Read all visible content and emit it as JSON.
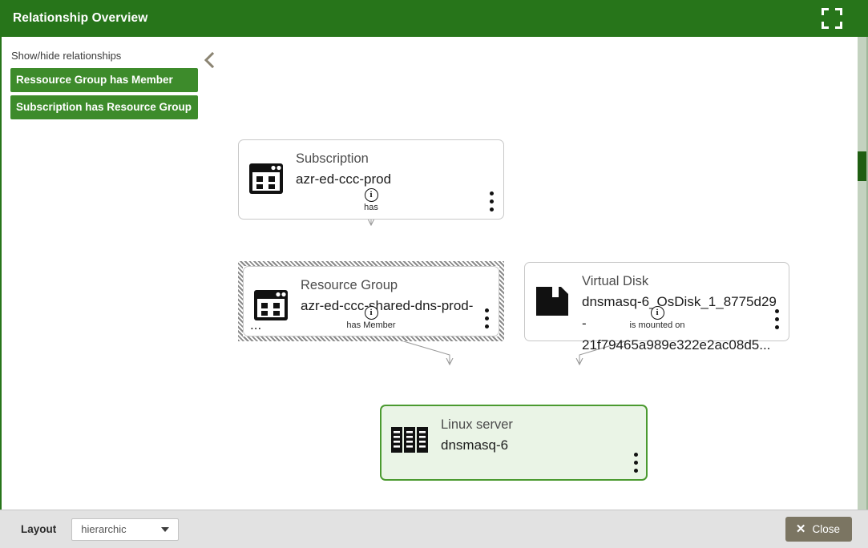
{
  "header": {
    "title": "Relationship Overview",
    "fullscreen_icon": "fullscreen-icon"
  },
  "sidebar": {
    "title": "Show/hide relationships",
    "collapse_icon": "chevron-left-icon",
    "buttons": [
      {
        "label": "Ressource Group has Member",
        "color": "#3d8b2b"
      },
      {
        "label": "Subscription has Resource Group",
        "color": "#3d8b2b"
      }
    ]
  },
  "graph": {
    "nodes": [
      {
        "id": "subscription",
        "type": "Subscription",
        "label": "azr-ed-ccc-prod",
        "icon": "window-grid-icon",
        "selected": false,
        "highlight": false
      },
      {
        "id": "resourcegroup",
        "type": "Resource Group",
        "label": "azr-ed-ccc-shared-dns-prod-",
        "label_cont": "...",
        "icon": "window-grid-icon",
        "selected": true,
        "highlight": false
      },
      {
        "id": "virtualdisk",
        "type": "Virtual Disk",
        "label": "dnsmasq-6_OsDisk_1_8775d29-",
        "label_cont": "21f79465a989e322e2ac08d5...",
        "icon": "floppy-disk-icon",
        "selected": false,
        "highlight": false
      },
      {
        "id": "linuxserver",
        "type": "Linux server",
        "label": "dnsmasq-6",
        "icon": "server-rack-icon",
        "selected": false,
        "highlight": true,
        "border_color": "#4b9a30",
        "fill_color": "#eaf4e6"
      }
    ],
    "edges": [
      {
        "id": "e1",
        "label": "has",
        "from": "subscription",
        "to": "resourcegroup",
        "info_icon": "info-icon"
      },
      {
        "id": "e2",
        "label": "has Member",
        "from": "resourcegroup",
        "to": "linuxserver",
        "info_icon": "info-icon"
      },
      {
        "id": "e3",
        "label": "is mounted on",
        "from": "virtualdisk",
        "to": "linuxserver",
        "info_icon": "info-icon"
      }
    ]
  },
  "footer": {
    "layout_label": "Layout",
    "layout_value": "hierarchic",
    "layout_options": [
      "hierarchic"
    ],
    "close_label": "Close",
    "close_icon": "close-x-icon"
  }
}
